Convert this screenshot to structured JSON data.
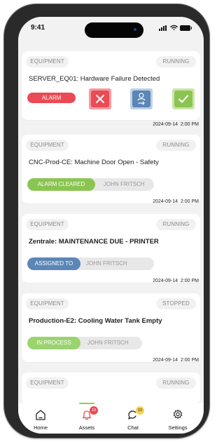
{
  "status_bar": {
    "time": "9:41"
  },
  "cards": [
    {
      "equipment_label": "EQUIPMENT",
      "state": "RUNNING",
      "title": "SERVER_EQ01: Hardware Failure Detected",
      "alarm_label": "ALARM",
      "date": "2024-09-14",
      "time": "2:00 PM"
    },
    {
      "equipment_label": "EQUIPMENT",
      "state": "RUNNING",
      "title": "CNC-Prod-CE: Machine Door Open - Safety",
      "status": "ALARM CLEARED",
      "person": "JOHN FRITSCH",
      "date": "2024-09-14",
      "time": "2:00 PM"
    },
    {
      "equipment_label": "EQUIPMENT",
      "state": "RUNNING",
      "title": "Zentrale:  MAINTENANCE DUE - PRINTER",
      "status": "ASSIGNED TO",
      "person": "JOHN FRITSCH",
      "date": "2024-09-14",
      "time": "2:00 PM"
    },
    {
      "equipment_label": "EQUIPMENT",
      "state": "STOPPED",
      "title": "Production-E2: Cooling Water Tank Empty",
      "status": "IN PROCESS",
      "person": "JOHN FRITSCH",
      "date": "2024-09-14",
      "time": "2:00 PM"
    },
    {
      "equipment_label": "EQUIPMENT",
      "state": "RUNNING"
    }
  ],
  "bottom_nav": {
    "home_label": "Home",
    "assets_label": "Assets",
    "assets_badge": "10",
    "chat_label": "Chat",
    "chat_badge": "10",
    "settings_label": "Settings"
  },
  "colors": {
    "alarm_red": "#ea4b54",
    "assign_blue": "#5b86b5",
    "success_green": "#8ac552",
    "progress_green": "#9bd36f",
    "badge_yellow": "#f5d24a"
  },
  "icons": [
    "close-icon",
    "user-assign-icon",
    "check-icon",
    "home-icon",
    "bell-icon",
    "chat-icon",
    "gear-icon"
  ]
}
